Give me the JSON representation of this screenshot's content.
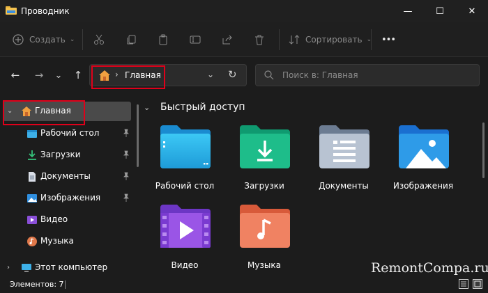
{
  "window": {
    "title": "Проводник",
    "minimize_icon": "—",
    "maximize_icon": "☐",
    "close_icon": "✕"
  },
  "toolbar": {
    "create_label": "Создать",
    "sort_label": "Сортировать",
    "more_label": "•••",
    "icons": [
      "cut-icon",
      "copy-icon",
      "paste-icon",
      "rename-icon",
      "share-icon",
      "delete-icon"
    ]
  },
  "nav": {
    "back": "←",
    "forward": "→",
    "recent": "⌄",
    "up": "↑",
    "address_sep": "›",
    "address_text": "Главная",
    "address_dropdown": "⌄",
    "refresh": "↻",
    "search_placeholder": "Поиск в: Главная"
  },
  "sidebar": {
    "home": "Главная",
    "items": [
      {
        "label": "Рабочий стол",
        "icon": "desktop-icon",
        "pinned": true
      },
      {
        "label": "Загрузки",
        "icon": "downloads-icon",
        "pinned": true
      },
      {
        "label": "Документы",
        "icon": "documents-icon",
        "pinned": true
      },
      {
        "label": "Изображения",
        "icon": "pictures-icon",
        "pinned": true
      },
      {
        "label": "Видео",
        "icon": "videos-icon",
        "pinned": false
      },
      {
        "label": "Музыка",
        "icon": "music-icon",
        "pinned": false
      }
    ],
    "this_pc": "Этот компьютер"
  },
  "main": {
    "section_title": "Быстрый доступ",
    "tiles": [
      {
        "label": "Рабочий стол",
        "icon": "desktop-folder-icon"
      },
      {
        "label": "Загрузки",
        "icon": "downloads-folder-icon"
      },
      {
        "label": "Документы",
        "icon": "documents-folder-icon"
      },
      {
        "label": "Изображения",
        "icon": "pictures-folder-icon"
      },
      {
        "label": "Видео",
        "icon": "videos-folder-icon"
      },
      {
        "label": "Музыка",
        "icon": "music-folder-icon"
      }
    ]
  },
  "status": {
    "items_count": "Элементов: 7"
  },
  "watermark": "RemontCompa.ru",
  "colors": {
    "highlight": "#e0001a",
    "selected_bg": "#4a4a4a",
    "background": "#1c1c1c"
  }
}
